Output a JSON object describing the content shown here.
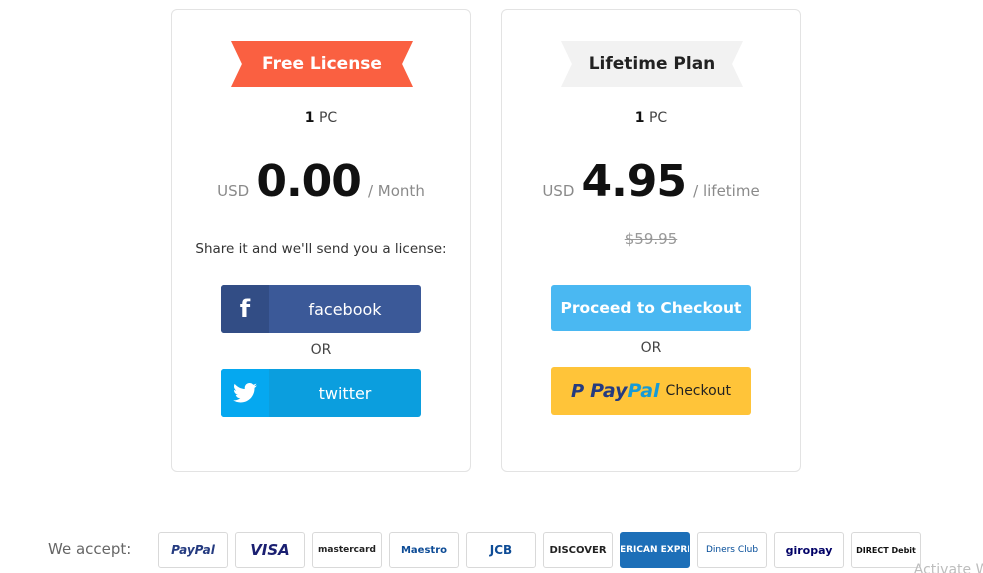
{
  "free_card": {
    "ribbon": "Free License",
    "pc_count": "1",
    "pc_unit": "PC",
    "currency": "USD",
    "price": "0.00",
    "period": "/ Month",
    "share_text": "Share it and we'll send you a license:",
    "facebook_label": "facebook",
    "facebook_icon": "f",
    "or_text": "OR",
    "twitter_label": "twitter"
  },
  "lifetime_card": {
    "ribbon": "Lifetime Plan",
    "pc_count": "1",
    "pc_unit": "PC",
    "currency": "USD",
    "price": "4.95",
    "period": "/ lifetime",
    "old_price": "$59.95",
    "checkout_label": "Proceed to Checkout",
    "or_text": "OR",
    "paypal_word_1": "Pay",
    "paypal_word_2": "Pal",
    "paypal_mark": "P",
    "paypal_checkout": "Checkout"
  },
  "accept": {
    "label": "We accept:",
    "methods": [
      "PayPal",
      "VISA",
      "mastercard",
      "Maestro",
      "JCB",
      "DISCOVER",
      "AMERICAN EXPRESS",
      "Diners Club",
      "giropay",
      "DIRECT Debit"
    ]
  },
  "watermark": "Activate Wi",
  "colors": {
    "free_ribbon": "#fa6041",
    "facebook": "#3b5998",
    "twitter": "#0b9ede",
    "checkout": "#4ab8f2",
    "paypal": "#ffc439"
  }
}
